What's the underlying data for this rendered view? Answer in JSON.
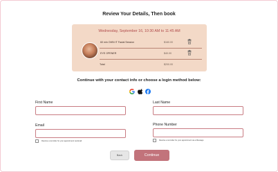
{
  "page": {
    "title": "Review Your Details, Then book"
  },
  "summary": {
    "date_line": "Wednesday, September 16, 10:30 AM to 11:45 AM",
    "services": [
      {
        "name": "60 min OWN IT Facial Session",
        "price": "$160.00"
      },
      {
        "name": "EYE OPENER",
        "price": "$40.00"
      }
    ],
    "total_label": "Total",
    "total_price": "$200.00"
  },
  "contact": {
    "heading": "Continue with your contact info or choose a login method below:",
    "login_methods": [
      "google-icon",
      "apple-icon",
      "facebook-icon"
    ]
  },
  "form": {
    "first_name_label": "First Name",
    "first_name_value": "",
    "last_name_label": "Last Name",
    "last_name_value": "",
    "email_label": "Email",
    "email_value": "",
    "phone_label": "Phone Number",
    "phone_value": "",
    "email_reminder": "Receive a reminder for your appointment via Email",
    "sms_reminder": "Receive a reminder for your appointment via a Message"
  },
  "actions": {
    "back_label": "Back",
    "continue_label": "Continue"
  },
  "colors": {
    "accent": "#c2737b",
    "summary_bg": "#f3d9c7",
    "date_text": "#b04a4a",
    "input_border": "#c87b82"
  }
}
